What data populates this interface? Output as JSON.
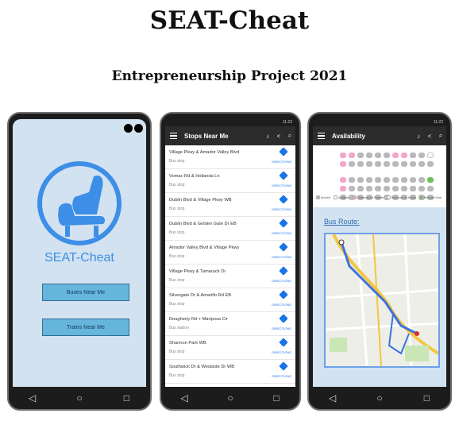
{
  "header": {
    "title": "SEAT-Cheat",
    "subtitle": "Entrepreneurship Project 2021"
  },
  "phone1": {
    "app_name": "SEAT-Cheat",
    "buses_button": "Buses Near Me",
    "trains_button": "Trains Near Me"
  },
  "phone2": {
    "status_time": "11:22",
    "title": "Stops Near Me",
    "directions_label": "DIRECTIONS",
    "stops": [
      {
        "name": "Village Pkwy & Amador Valley Blvd",
        "type": "Bus stop"
      },
      {
        "name": "Vomac Rd & Hollanda Ln",
        "type": "Bus stop"
      },
      {
        "name": "Dublin Blvd & Village Pkwy WB",
        "type": "Bus stop"
      },
      {
        "name": "Dublin Blvd & Golden Gate Dr EB",
        "type": "Bus stop"
      },
      {
        "name": "Amador Valley Blvd & Village Pkwy",
        "type": "Bus stop"
      },
      {
        "name": "Village Pkwy & Tamarack Dr",
        "type": "Bus stop"
      },
      {
        "name": "Silvergate Dr & Amarillo Rd EB",
        "type": "Bus stop"
      },
      {
        "name": "Dougherty Rd + Mariposa Cir",
        "type": "Bus station"
      },
      {
        "name": "Shannon Park WB",
        "type": "Bus stop"
      },
      {
        "name": "Southwick Dr & Westside Dr WB",
        "type": "Bus stop"
      }
    ]
  },
  "phone3": {
    "title": "Availability",
    "route_label": "Bus Route:",
    "legend": [
      {
        "label": "Booked",
        "color": "#b9b9b9"
      },
      {
        "label": "Available",
        "color": "#ffffff"
      },
      {
        "label": "Reserved for Female",
        "color": "#f2a6c8"
      },
      {
        "label": "Reserved for Senior",
        "color": "#ffffff"
      },
      {
        "label": "Selected Seat",
        "color": "#6fbf5a"
      }
    ]
  },
  "colors": {
    "brand_blue": "#3d8ee6",
    "button_blue": "#66b5db",
    "screen_bg": "#d2e2f0",
    "app_bar": "#2c2c2c",
    "link_blue": "#1a73e8"
  }
}
